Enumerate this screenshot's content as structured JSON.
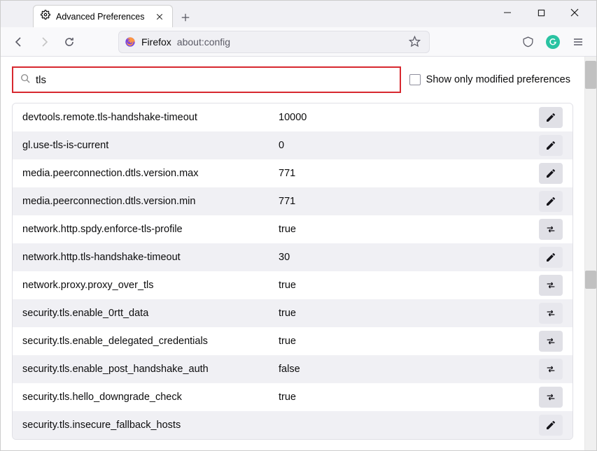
{
  "window": {
    "tab_title": "Advanced Preferences"
  },
  "urlbar": {
    "brand": "Firefox",
    "path": "about:config"
  },
  "search": {
    "value": "tls",
    "checkbox_label": "Show only modified preferences"
  },
  "prefs": [
    {
      "name": "devtools.remote.tls-handshake-timeout",
      "value": "10000",
      "action": "edit"
    },
    {
      "name": "gl.use-tls-is-current",
      "value": "0",
      "action": "edit"
    },
    {
      "name": "media.peerconnection.dtls.version.max",
      "value": "771",
      "action": "edit"
    },
    {
      "name": "media.peerconnection.dtls.version.min",
      "value": "771",
      "action": "edit"
    },
    {
      "name": "network.http.spdy.enforce-tls-profile",
      "value": "true",
      "action": "toggle"
    },
    {
      "name": "network.http.tls-handshake-timeout",
      "value": "30",
      "action": "edit"
    },
    {
      "name": "network.proxy.proxy_over_tls",
      "value": "true",
      "action": "toggle"
    },
    {
      "name": "security.tls.enable_0rtt_data",
      "value": "true",
      "action": "toggle"
    },
    {
      "name": "security.tls.enable_delegated_credentials",
      "value": "true",
      "action": "toggle"
    },
    {
      "name": "security.tls.enable_post_handshake_auth",
      "value": "false",
      "action": "toggle"
    },
    {
      "name": "security.tls.hello_downgrade_check",
      "value": "true",
      "action": "toggle"
    },
    {
      "name": "security.tls.insecure_fallback_hosts",
      "value": "",
      "action": "edit"
    }
  ]
}
